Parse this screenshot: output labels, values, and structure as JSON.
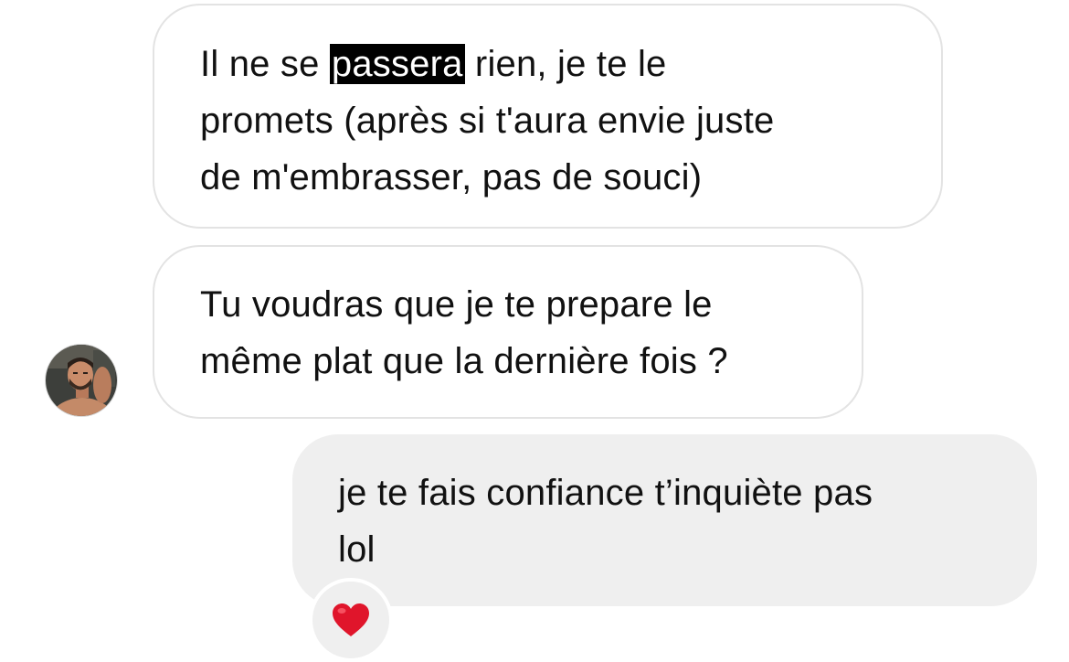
{
  "messages": [
    {
      "direction": "incoming",
      "lines": [
        {
          "before": "Il ne se ",
          "highlight": "passera",
          "after": " rien, je te le"
        },
        {
          "text": "promets (après si t'aura envie juste"
        },
        {
          "text": "de m'embrasser, pas de souci)"
        }
      ]
    },
    {
      "direction": "incoming",
      "lines": [
        {
          "text": "Tu voudras que je te prepare le"
        },
        {
          "text": "même plat que la dernière fois ?"
        }
      ]
    },
    {
      "direction": "outgoing",
      "lines": [
        {
          "text": "je te fais confiance t’inquiète pas"
        },
        {
          "text": "lol"
        }
      ],
      "reaction": "❤️"
    }
  ],
  "avatar": {
    "icon": "profile-photo"
  },
  "colors": {
    "incoming_bg": "#ffffff",
    "incoming_border": "#e3e3e3",
    "outgoing_bg": "#efefef",
    "text": "#111111",
    "highlight_bg": "#000000",
    "highlight_text": "#ffffff",
    "heart": "#e0152b"
  }
}
